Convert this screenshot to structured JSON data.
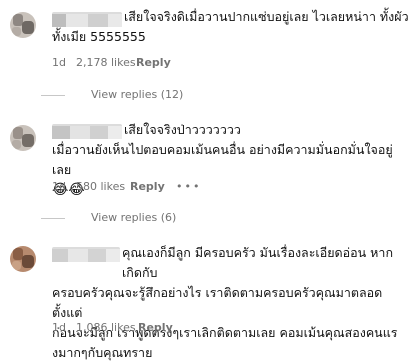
{
  "comments": [
    {
      "text_lines": [
        "เสียใจจริงดิเมื่อวานปากแซ่บอยู่เลย ไวเลยหน่าา ทั้งผัว",
        "ทั้งเมีย 5555555"
      ],
      "time": "1d",
      "likes": "2,178 likes",
      "reply": "Reply",
      "view_replies": "View replies (12)"
    },
    {
      "text_lines": [
        "เสียใจจริงป่าววววววว",
        "เมื่อวานยังเห็นไปตอบคอมเม้นคนอื่น อย่างมีความมั่นอกมั่นใจอยู่เลย"
      ],
      "emoji": "😂😂",
      "time": "1d",
      "likes": "580 likes",
      "reply": "Reply",
      "more": "•••",
      "view_replies": "View replies (6)"
    },
    {
      "text_lines": [
        "คุณเองก็มีลูก มีครอบครัว มันเรื่องละเอียดอ่อน หากเกิดกับ",
        "ครอบครัวคุณจะรู้สึกอย่างไร เราติดตามครอบครัวคุณมาตลอดตั้งแต่",
        "ก่อนจะมีลูก เราพูดตรงๆเราเลิกติดตามเลย คอมเม้นคุณสองคนแร",
        "งมากๆกับคุณทราย"
      ],
      "time": "1d",
      "likes": "1,086 likes",
      "reply": "Reply"
    }
  ]
}
